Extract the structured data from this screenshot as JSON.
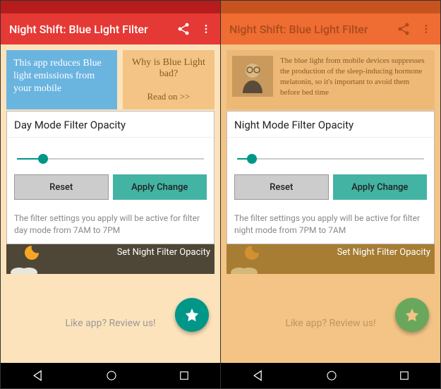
{
  "left": {
    "title": "Night Shift: Blue Light Filter",
    "info_blue": "This app reduces Blue light emissions from your mobile",
    "info_orange_q": "Why is Blue Light bad?",
    "info_orange_link": "Read on >>",
    "card_header": "Day Mode Filter Opacity",
    "reset": "Reset",
    "apply": "Apply Change",
    "footer": "The filter settings you apply will be active for filter day mode from 7AM to 7PM",
    "night_bar": "Set Night Filter Opacity",
    "review": "Like app? Review us!"
  },
  "right": {
    "title": "Night Shift: Blue Light Filter",
    "info_text": "The blue light from mobile devices suppresses the production of the sleep-inducing hormone melatonin, so it's important to avoid them before bed time",
    "card_header": "Night Mode Filter Opacity",
    "reset": "Reset",
    "apply": "Apply Change",
    "footer": "The filter settings you apply will be active for filter night mode from 7PM to 7AM",
    "night_bar": "Set Night Filter Opacity",
    "review": "Like app? Review us!"
  }
}
